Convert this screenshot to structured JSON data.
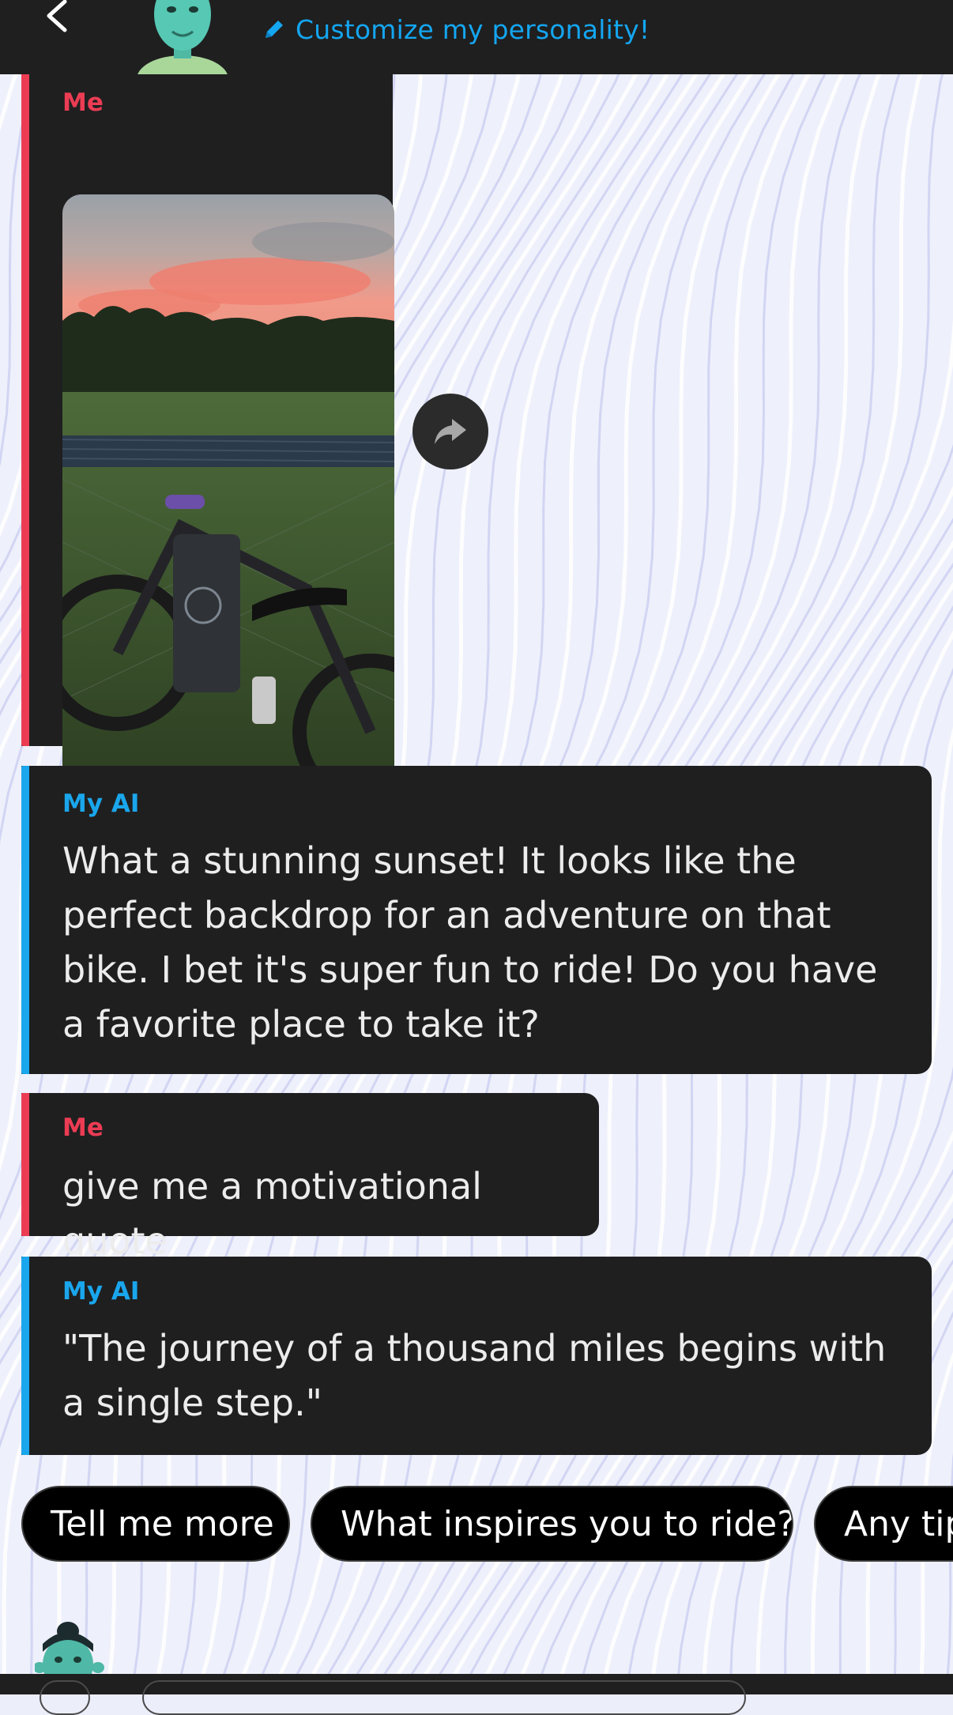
{
  "header": {
    "customize_label": "Customize my personality!"
  },
  "messages": [
    {
      "sender": "Me",
      "type": "image"
    },
    {
      "sender": "My AI",
      "text": "What a stunning sunset! It looks like the perfect backdrop for an adventure on that bike. I bet it's super fun to ride! Do you have a favorite place to take it?"
    },
    {
      "sender": "Me",
      "text": "give me a motivational quote"
    },
    {
      "sender": "My AI",
      "text": "\"The journey of a thousand miles begins with a single step.\""
    }
  ],
  "suggestions": [
    "Tell me more",
    "What inspires you to ride?",
    "Any tip"
  ],
  "colors": {
    "me_accent": "#ec3c54",
    "ai_accent": "#1aa6ec",
    "bubble_bg": "#1f1f20",
    "link": "#14a6f0"
  },
  "icons": {
    "back": "chevron-left-icon",
    "edit": "pencil-icon",
    "share": "share-arrow-icon"
  }
}
